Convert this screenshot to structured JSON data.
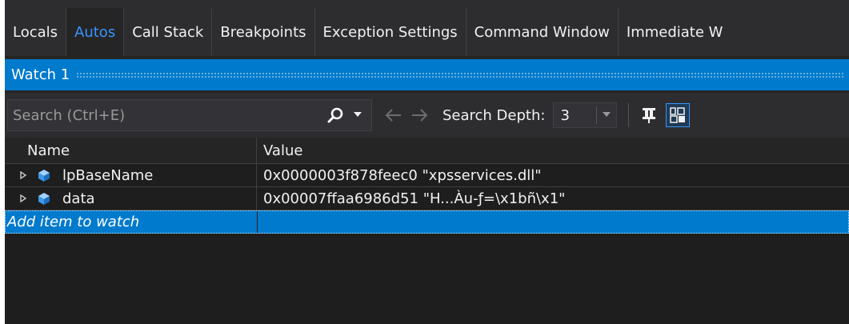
{
  "tabs": [
    {
      "label": "Locals",
      "active": false
    },
    {
      "label": "Autos",
      "active": true
    },
    {
      "label": "Call Stack",
      "active": false
    },
    {
      "label": "Breakpoints",
      "active": false
    },
    {
      "label": "Exception Settings",
      "active": false
    },
    {
      "label": "Command Window",
      "active": false
    },
    {
      "label": "Immediate W",
      "active": false
    }
  ],
  "window": {
    "title": "Watch 1"
  },
  "toolbar": {
    "search_placeholder": "Search (Ctrl+E)",
    "search_depth_label": "Search Depth:",
    "search_depth_value": "3"
  },
  "grid": {
    "columns": {
      "name": "Name",
      "value": "Value"
    },
    "rows": [
      {
        "name": "lpBaseName",
        "value": "0x0000003f878feec0 \"xpsservices.dll\""
      },
      {
        "name": "data",
        "value": "0x00007ffaa6986d51 \"H...Àu-ƒ=\\x1bñ\\x1\""
      }
    ],
    "add_item_label": "Add item to watch"
  },
  "colors": {
    "accent": "#007acc",
    "active_tab": "#3794ff",
    "background": "#252526",
    "grid_background": "#1e1e1e"
  },
  "icons": {
    "search": "magnifier-icon",
    "back": "arrow-left-icon",
    "forward": "arrow-right-icon",
    "pin": "pin-icon",
    "hex": "hex-display-icon",
    "variable": "cube-icon"
  }
}
